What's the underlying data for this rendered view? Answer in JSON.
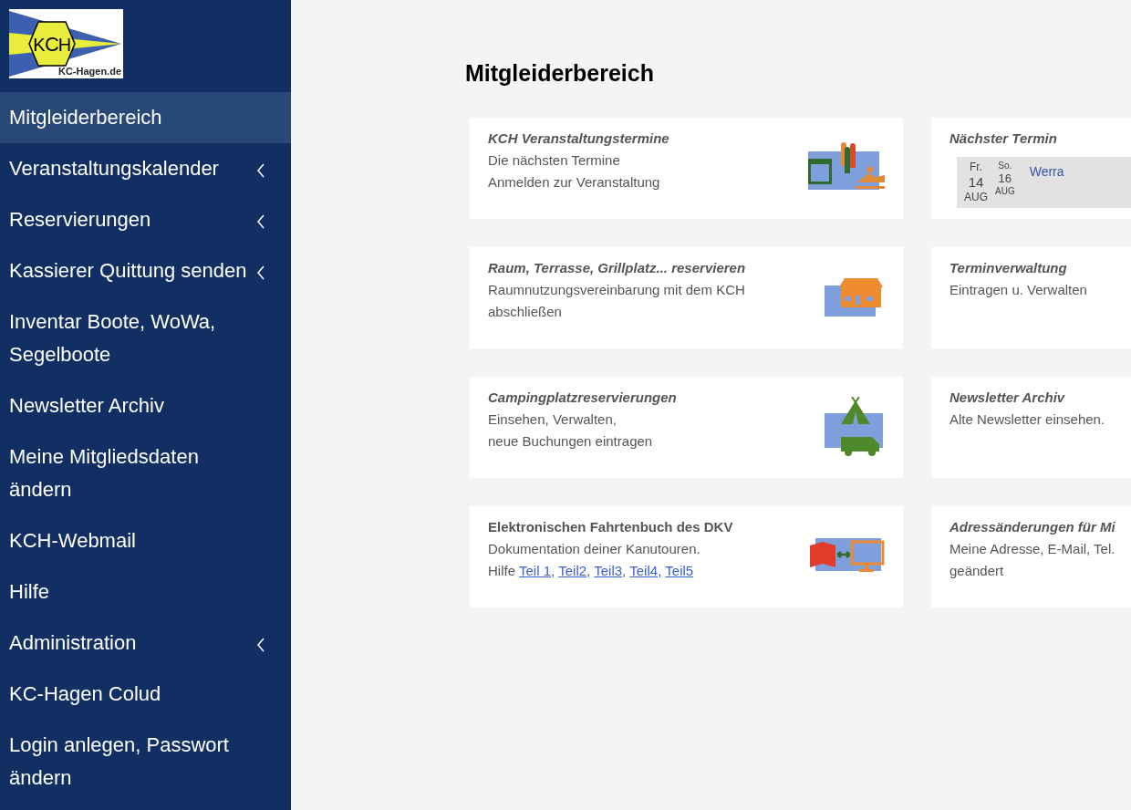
{
  "logo": {
    "letters": [
      "K",
      "C",
      "H"
    ],
    "domain": "KC-Hagen.de"
  },
  "sidebar": {
    "items": [
      {
        "label": "Mitgleiderbereich",
        "selected": true,
        "has_submenu": false
      },
      {
        "label": "Veranstaltungskalender",
        "selected": false,
        "has_submenu": true
      },
      {
        "label": "Reservierungen",
        "selected": false,
        "has_submenu": true
      },
      {
        "label": "Kassierer Quittung senden",
        "selected": false,
        "has_submenu": true
      },
      {
        "label": "Inventar Boote, WoWa, Segelboote",
        "selected": false,
        "has_submenu": false
      },
      {
        "label": "Newsletter Archiv",
        "selected": false,
        "has_submenu": false
      },
      {
        "label": "Meine Mitgliedsdaten ändern",
        "selected": false,
        "has_submenu": false
      },
      {
        "label": "KCH-Webmail",
        "selected": false,
        "has_submenu": false
      },
      {
        "label": "Hilfe",
        "selected": false,
        "has_submenu": false
      },
      {
        "label": "Administration",
        "selected": false,
        "has_submenu": true
      },
      {
        "label": "KC-Hagen Colud",
        "selected": false,
        "has_submenu": false
      },
      {
        "label": "Login anlegen, Passwort ändern",
        "selected": false,
        "has_submenu": false
      }
    ]
  },
  "heading": "Mitgleiderbereich",
  "cards": [
    {
      "title": "KCH Veranstaltungstermine",
      "title_italic": true,
      "lines": [
        "Die nächsten Termine",
        "Anmelden zur Veranstaltung"
      ],
      "kind": "calendar-people"
    },
    {
      "title": "Nächster Termin",
      "title_italic": true,
      "event": {
        "dates": [
          {
            "kind": "start",
            "weekday": "Fr.",
            "day": "14",
            "month": "AUG"
          },
          {
            "kind": "end",
            "weekday": "So.",
            "day": "16",
            "month": "AUG"
          }
        ],
        "name": "Werra"
      }
    },
    {
      "title": "Raum, Terrasse, Grillplatz... reservieren",
      "title_italic": true,
      "lines": [
        "Raumnutzungsvereinbarung mit dem KCH",
        "abschließen"
      ],
      "kind": "house"
    },
    {
      "title": "Terminverwaltung",
      "title_italic": true,
      "lines": [
        "Eintragen u. Verwalten"
      ]
    },
    {
      "title": "Campingplatzreservierungen",
      "title_italic": true,
      "lines": [
        "Einsehen, Verwalten,",
        "neue Buchungen eintragen"
      ],
      "kind": "camping"
    },
    {
      "title": "Newsletter Archiv",
      "title_italic": true,
      "lines": [
        "Alte Newsletter einsehen."
      ]
    },
    {
      "title": "Elektronischen Fahrtenbuch des DKV",
      "title_italic": false,
      "lines": [
        "Dokumentation deiner Kanutouren."
      ],
      "help": {
        "label": "Hilfe",
        "separator": ",",
        "links": [
          "Teil 1",
          "Teil2",
          "Teil3",
          "Teil4",
          "Teil5"
        ]
      },
      "kind": "book-monitor"
    },
    {
      "title": "Adressänderungen für Mi",
      "title_italic": true,
      "lines": [
        "Meine Adresse, E-Mail, Tel.",
        "geändert"
      ]
    }
  ]
}
